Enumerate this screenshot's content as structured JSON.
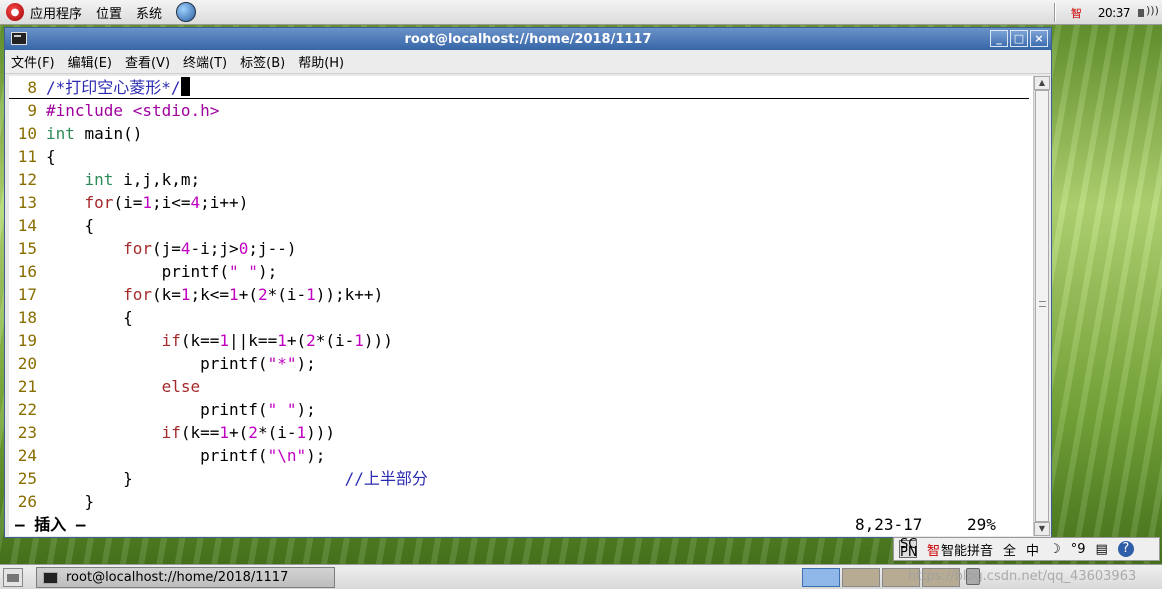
{
  "top_panel": {
    "menus": [
      "应用程序",
      "位置",
      "系统"
    ],
    "ime_indicator": "智",
    "clock": "20:37"
  },
  "window": {
    "title": "root@localhost://home/2018/1117",
    "buttons": [
      "_",
      "□",
      "×"
    ]
  },
  "menubar": [
    "文件(F)",
    "编辑(E)",
    "查看(V)",
    "终端(T)",
    "标签(B)",
    "帮助(H)"
  ],
  "editor": {
    "lines": [
      {
        "n": "8",
        "parts": [
          {
            "t": "/*打印空心菱形*/",
            "c": "cmt"
          }
        ],
        "cursor": true
      },
      {
        "n": "9",
        "parts": [
          {
            "t": "#include <stdio.h>",
            "c": "pre"
          }
        ]
      },
      {
        "n": "10",
        "parts": [
          {
            "t": "int",
            "c": "kw-type"
          },
          {
            "t": " main()",
            "c": "plain"
          }
        ]
      },
      {
        "n": "11",
        "parts": [
          {
            "t": "{",
            "c": "plain"
          }
        ]
      },
      {
        "n": "12",
        "parts": [
          {
            "t": "    ",
            "c": "plain"
          },
          {
            "t": "int",
            "c": "kw-type"
          },
          {
            "t": " i,j,k,m;",
            "c": "plain"
          }
        ]
      },
      {
        "n": "13",
        "parts": [
          {
            "t": "    ",
            "c": "plain"
          },
          {
            "t": "for",
            "c": "kw-stmt"
          },
          {
            "t": "(i=",
            "c": "plain"
          },
          {
            "t": "1",
            "c": "num"
          },
          {
            "t": ";i<=",
            "c": "plain"
          },
          {
            "t": "4",
            "c": "num"
          },
          {
            "t": ";i++)",
            "c": "plain"
          }
        ]
      },
      {
        "n": "14",
        "parts": [
          {
            "t": "    {",
            "c": "plain"
          }
        ]
      },
      {
        "n": "15",
        "parts": [
          {
            "t": "        ",
            "c": "plain"
          },
          {
            "t": "for",
            "c": "kw-stmt"
          },
          {
            "t": "(j=",
            "c": "plain"
          },
          {
            "t": "4",
            "c": "num"
          },
          {
            "t": "-i;j>",
            "c": "plain"
          },
          {
            "t": "0",
            "c": "num"
          },
          {
            "t": ";j--)",
            "c": "plain"
          }
        ]
      },
      {
        "n": "16",
        "parts": [
          {
            "t": "            printf(",
            "c": "plain"
          },
          {
            "t": "\" \"",
            "c": "str"
          },
          {
            "t": ");",
            "c": "plain"
          }
        ]
      },
      {
        "n": "17",
        "parts": [
          {
            "t": "        ",
            "c": "plain"
          },
          {
            "t": "for",
            "c": "kw-stmt"
          },
          {
            "t": "(k=",
            "c": "plain"
          },
          {
            "t": "1",
            "c": "num"
          },
          {
            "t": ";k<=",
            "c": "plain"
          },
          {
            "t": "1",
            "c": "num"
          },
          {
            "t": "+(",
            "c": "plain"
          },
          {
            "t": "2",
            "c": "num"
          },
          {
            "t": "*(i-",
            "c": "plain"
          },
          {
            "t": "1",
            "c": "num"
          },
          {
            "t": "));k++)",
            "c": "plain"
          }
        ]
      },
      {
        "n": "18",
        "parts": [
          {
            "t": "        {",
            "c": "plain"
          }
        ]
      },
      {
        "n": "19",
        "parts": [
          {
            "t": "            ",
            "c": "plain"
          },
          {
            "t": "if",
            "c": "kw-stmt"
          },
          {
            "t": "(k==",
            "c": "plain"
          },
          {
            "t": "1",
            "c": "num"
          },
          {
            "t": "||k==",
            "c": "plain"
          },
          {
            "t": "1",
            "c": "num"
          },
          {
            "t": "+(",
            "c": "plain"
          },
          {
            "t": "2",
            "c": "num"
          },
          {
            "t": "*(i-",
            "c": "plain"
          },
          {
            "t": "1",
            "c": "num"
          },
          {
            "t": ")))",
            "c": "plain"
          }
        ]
      },
      {
        "n": "20",
        "parts": [
          {
            "t": "                printf(",
            "c": "plain"
          },
          {
            "t": "\"*\"",
            "c": "str"
          },
          {
            "t": ");",
            "c": "plain"
          }
        ]
      },
      {
        "n": "21",
        "parts": [
          {
            "t": "            ",
            "c": "plain"
          },
          {
            "t": "else",
            "c": "kw-stmt"
          }
        ]
      },
      {
        "n": "22",
        "parts": [
          {
            "t": "                printf(",
            "c": "plain"
          },
          {
            "t": "\" \"",
            "c": "str"
          },
          {
            "t": ");",
            "c": "plain"
          }
        ]
      },
      {
        "n": "23",
        "parts": [
          {
            "t": "            ",
            "c": "plain"
          },
          {
            "t": "if",
            "c": "kw-stmt"
          },
          {
            "t": "(k==",
            "c": "plain"
          },
          {
            "t": "1",
            "c": "num"
          },
          {
            "t": "+(",
            "c": "plain"
          },
          {
            "t": "2",
            "c": "num"
          },
          {
            "t": "*(i-",
            "c": "plain"
          },
          {
            "t": "1",
            "c": "num"
          },
          {
            "t": ")))",
            "c": "plain"
          }
        ]
      },
      {
        "n": "24",
        "parts": [
          {
            "t": "                printf(",
            "c": "plain"
          },
          {
            "t": "\"\\n\"",
            "c": "str"
          },
          {
            "t": ");",
            "c": "plain"
          }
        ]
      },
      {
        "n": "25",
        "parts": [
          {
            "t": "        }                      ",
            "c": "plain"
          },
          {
            "t": "//上半部分",
            "c": "cmt"
          }
        ]
      },
      {
        "n": "26",
        "parts": [
          {
            "t": "    }",
            "c": "plain"
          }
        ]
      }
    ],
    "status_mode": "— 插入 —",
    "status_position": "8,23-17",
    "status_percent": "29%"
  },
  "ime_bar": {
    "logo": "SC PN",
    "ime_icon": "智",
    "ime_name": "智能拼音",
    "full_width": "全",
    "language": "中",
    "moon": "☽",
    "punct": "°9",
    "keyboard": "▤",
    "help": "?"
  },
  "bottom_panel": {
    "task_label": "root@localhost://home/2018/1117",
    "watermark": "https://blog.csdn.net/qq_43603963"
  }
}
